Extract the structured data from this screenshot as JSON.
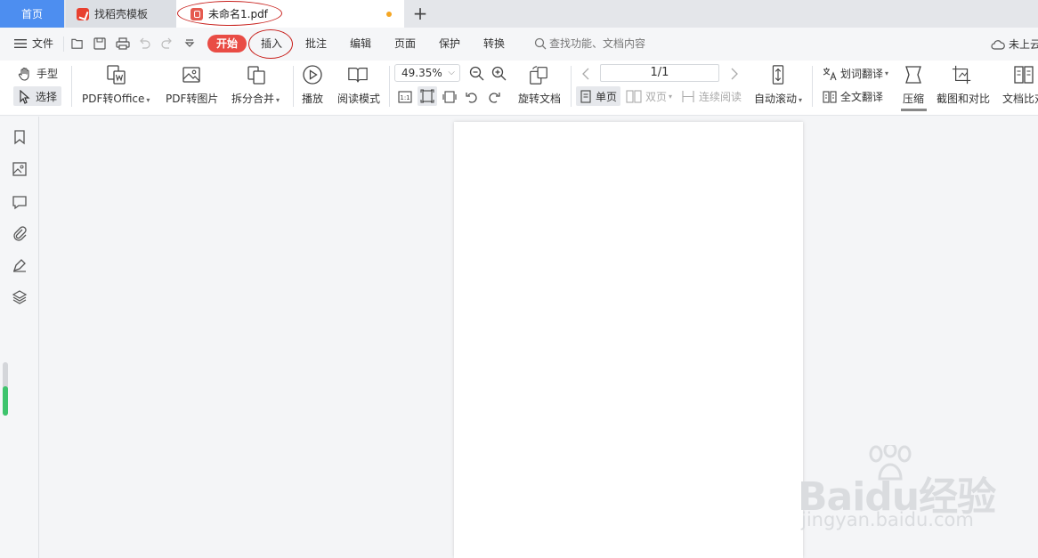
{
  "tabs": {
    "home": "首页",
    "template": "找稻壳模板",
    "document": "未命名1.pdf",
    "new_tab": "+"
  },
  "menu": {
    "file": "文件",
    "start": "开始",
    "insert": "插入",
    "annotate": "批注",
    "edit": "编辑",
    "page": "页面",
    "protect": "保护",
    "convert": "转换",
    "search_placeholder": "查找功能、文档内容",
    "cloud": "未上云"
  },
  "ribbon": {
    "hand": "手型",
    "select": "选择",
    "pdf_to_office": "PDF转Office",
    "pdf_to_image": "PDF转图片",
    "split_merge": "拆分合并",
    "play": "播放",
    "read_mode": "阅读模式",
    "zoom": "49.35%",
    "rotate_doc": "旋转文档",
    "page_indicator": "1/1",
    "single_page": "单页",
    "double_page": "双页",
    "continuous": "连续阅读",
    "auto_scroll": "自动滚动",
    "word_translate": "划词翻译",
    "full_translate": "全文翻译",
    "compress": "压缩",
    "screenshot_compare": "截图和对比",
    "doc_compare": "文档比对"
  },
  "watermark": {
    "brand": "Baidu经验",
    "url": "jingyan.baidu.com"
  },
  "colors": {
    "home_tab": "#4d8ef0",
    "start_button": "#e94c45",
    "annotation_circle": "#c8201c",
    "unsaved_dot": "#f5a623",
    "scroll_thumb": "#3ec46d"
  }
}
